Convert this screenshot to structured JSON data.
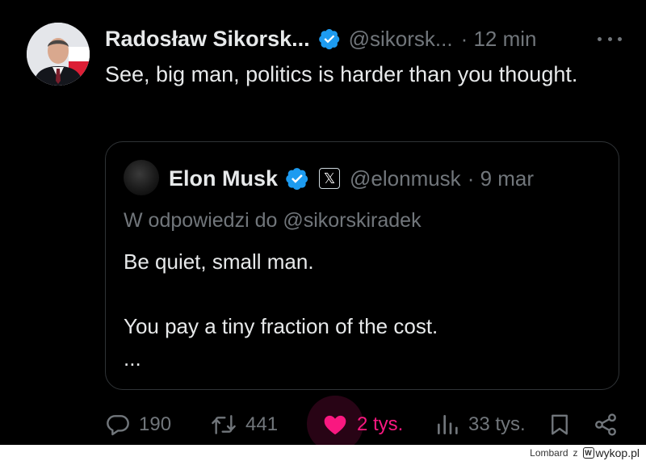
{
  "tweet": {
    "author_name": "Radosław Sikorsk...",
    "handle": "@sikorsk...",
    "time": "· 12 min",
    "text": "See, big man, politics is harder than you thought.",
    "verified_icon": "verified-badge-icon",
    "more_icon": "more-dots-icon"
  },
  "quote": {
    "author_name": "Elon Musk",
    "badge_glyph": "𝕏",
    "handle": "@elonmusk",
    "time": "· 9 mar",
    "reply_to": "W odpowiedzi do @sikorskiradek",
    "text": "Be quiet, small man.\n\nYou pay a tiny fraction of the cost.\n..."
  },
  "actions": {
    "replies": "190",
    "reposts": "441",
    "likes": "2 tys.",
    "views": "33 tys."
  },
  "colors": {
    "background": "#000000",
    "text": "#e7e9ea",
    "muted": "#71767b",
    "verified": "#1d9bf0",
    "like": "#f91880"
  },
  "footer": {
    "user": "Lombard",
    "separator": "z",
    "site": "wykop.pl",
    "logo_letter": "W"
  }
}
